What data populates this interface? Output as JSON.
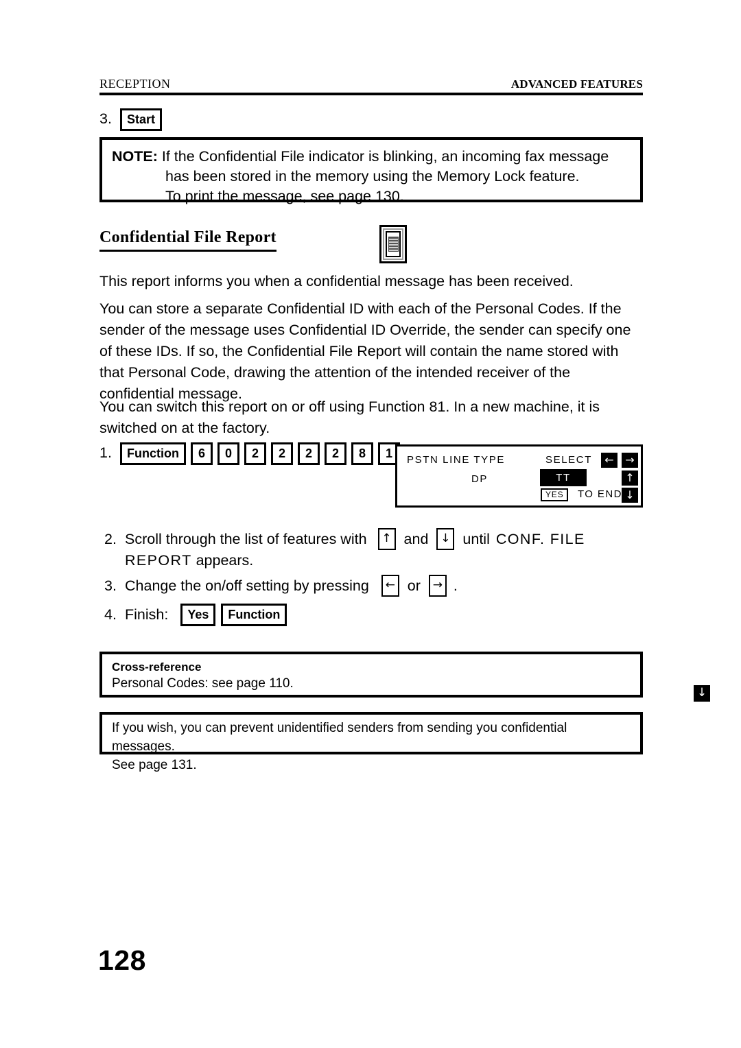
{
  "header": {
    "left": "RECEPTION",
    "right": "ADVANCED FEATURES"
  },
  "step3_top": {
    "number": "3.",
    "key": "Start"
  },
  "note": {
    "label": "NOTE:",
    "line1": "If the Confidential File indicator is blinking, an incoming fax message",
    "line2": "has been stored in the memory using the Memory Lock feature.",
    "line3": "To print the message, see page  130."
  },
  "section": {
    "title": "Confidential File Report",
    "icon": "report-page-icon"
  },
  "intro": "This report informs you when a confidential message has been received.",
  "paragraph1": "You can store a separate Confidential ID with each of the Personal Codes. If the sender of the message uses Confidential ID Override, the sender can specify one of these IDs. If so, the Confidential File Report will contain the name stored with that Personal Code, drawing the attention of the intended receiver of the confidential message.",
  "paragraph2": "You can switch this report on or off using Function 81. In a new machine, it is switched on at the factory.",
  "procedure": {
    "step1": {
      "number": "1.",
      "function_key": "Function",
      "digits": [
        "6",
        "0",
        "2",
        "2",
        "2",
        "2",
        "8",
        "1"
      ]
    },
    "step2": {
      "number": "2.",
      "text_before": "Scroll through the list of features with",
      "key_up": "↑",
      "text_middle": "and",
      "key_down": "↓",
      "text_after": "until",
      "display_value": "CONF. FILE",
      "line2_display": "REPORT",
      "line2_after": "appears."
    },
    "step3": {
      "number": "3.",
      "text_before": "Change the on/off setting by pressing",
      "key_left": "←",
      "text_middle": "or",
      "key_right": "→",
      "text_after": "."
    },
    "step4": {
      "number": "4.",
      "label": "Finish:",
      "key_yes": "Yes",
      "key_function": "Function"
    }
  },
  "lcd": {
    "line_type_label": "PSTN LINE TYPE",
    "select_label": "SELECT",
    "option_unselected": "DP",
    "option_selected": "TT",
    "yes_key": "YES",
    "to_end": "TO END",
    "arrow_left": "←",
    "arrow_right": "→",
    "arrow_up": "↑",
    "arrow_down": "↓"
  },
  "cross_reference": {
    "title": "Cross-reference",
    "text": "Personal Codes: see page 110."
  },
  "tip": {
    "line1": "If you wish, you can prevent unidentified senders from sending you confidential messages.",
    "line2": "See page 131."
  },
  "margin_marker": "↓",
  "page_number": "128"
}
